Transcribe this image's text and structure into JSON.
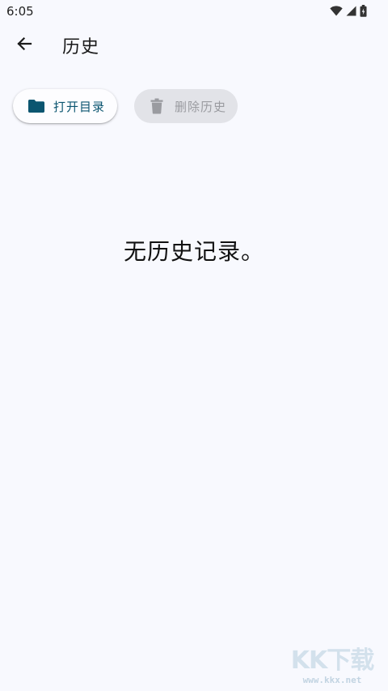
{
  "status_bar": {
    "time": "6:05",
    "icons": [
      "wifi-icon",
      "cell-signal-icon",
      "battery-icon"
    ]
  },
  "app_bar": {
    "back_icon": "arrow-back-icon",
    "title": "历史"
  },
  "actions": {
    "open_directory": {
      "label": "打开目录",
      "icon": "folder-icon",
      "color": "#0b5570"
    },
    "delete_history": {
      "label": "删除历史",
      "icon": "trash-icon",
      "enabled": false,
      "color": "#9a9ba0"
    }
  },
  "empty_state": {
    "message": "无历史记录。"
  },
  "watermark": {
    "logo": "KK下载",
    "url": "www.kkx.net"
  },
  "colors": {
    "background": "#f8f9fe",
    "accent": "#0b5570"
  }
}
